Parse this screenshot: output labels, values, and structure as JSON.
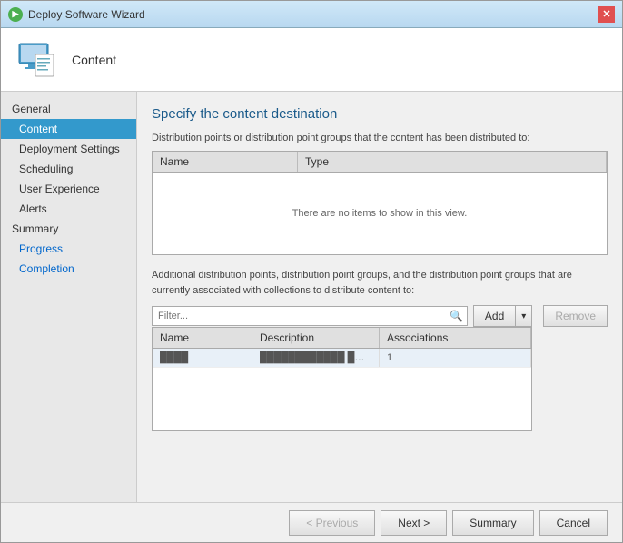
{
  "window": {
    "title": "Deploy Software Wizard",
    "close_label": "✕"
  },
  "header": {
    "icon_label": "content-icon",
    "title": "Content"
  },
  "sidebar": {
    "section_general": "General",
    "items": [
      {
        "id": "content",
        "label": "Content",
        "active": true
      },
      {
        "id": "deployment-settings",
        "label": "Deployment Settings",
        "active": false
      },
      {
        "id": "scheduling",
        "label": "Scheduling",
        "active": false
      },
      {
        "id": "user-experience",
        "label": "User Experience",
        "active": false
      },
      {
        "id": "alerts",
        "label": "Alerts",
        "active": false
      }
    ],
    "section_summary": "Summary",
    "extra_items": [
      {
        "id": "progress",
        "label": "Progress"
      },
      {
        "id": "completion",
        "label": "Completion"
      }
    ]
  },
  "content": {
    "page_title": "Specify the content destination",
    "upper_description": "Distribution points or distribution point groups that the content has been distributed to:",
    "upper_table": {
      "columns": [
        "Name",
        "Type"
      ],
      "empty_message": "There are no items to show in this view."
    },
    "lower_description": "Additional distribution points, distribution point groups, and the distribution point groups that are currently associated with collections to distribute content to:",
    "filter_placeholder": "Filter...",
    "add_label": "Add",
    "add_dropdown": "▾",
    "remove_label": "Remove",
    "lower_table": {
      "columns": [
        "Name",
        "Description",
        "Associations"
      ],
      "rows": [
        {
          "name": "████",
          "description": "████████████ ████",
          "associations": "1"
        }
      ]
    }
  },
  "footer": {
    "previous_label": "< Previous",
    "next_label": "Next >",
    "summary_label": "Summary",
    "cancel_label": "Cancel"
  }
}
